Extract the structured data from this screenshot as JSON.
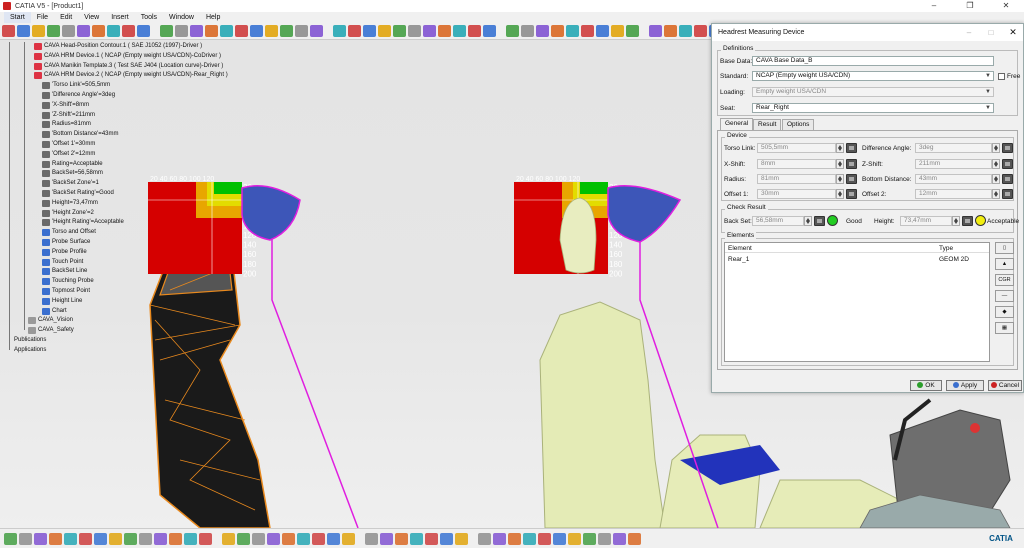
{
  "window": {
    "title": "CATIA V5 - [Product1]"
  },
  "menu": [
    "Start",
    "File",
    "Edit",
    "View",
    "Insert",
    "Tools",
    "Window",
    "Help"
  ],
  "tree": {
    "nodes": [
      {
        "label": "CAVA Head-Position Contour.1 ( SAE J1052 (1997)-Driver )",
        "icon": "red"
      },
      {
        "label": "CAVA HRM Device.1 ( NCAP (Empty weight USA/CDN)-CoDriver )",
        "icon": "red"
      },
      {
        "label": "CAVA Manikin Template.3 ( Test SAE J404 (Location curve)-Driver )",
        "icon": "red"
      },
      {
        "label": "CAVA HRM Device.2 ( NCAP (Empty weight USA/CDN)-Rear_Right )",
        "icon": "red"
      },
      {
        "label": "'Torso Link'=505,5mm",
        "icon": "param"
      },
      {
        "label": "'Difference Angle'=3deg",
        "icon": "param"
      },
      {
        "label": "'X-Shift'=8mm",
        "icon": "param"
      },
      {
        "label": "'Z-Shift'=211mm",
        "icon": "param"
      },
      {
        "label": "Radius=81mm",
        "icon": "param"
      },
      {
        "label": "'Bottom Distance'=43mm",
        "icon": "param"
      },
      {
        "label": "'Offset 1'=30mm",
        "icon": "param"
      },
      {
        "label": "'Offset 2'=12mm",
        "icon": "param"
      },
      {
        "label": "Rating=Acceptable",
        "icon": "param"
      },
      {
        "label": "BackSet=56,58mm",
        "icon": "param"
      },
      {
        "label": "'BackSet Zone'=1",
        "icon": "param"
      },
      {
        "label": "'BackSet Rating'=Good",
        "icon": "param"
      },
      {
        "label": "Height=73,47mm",
        "icon": "param"
      },
      {
        "label": "'Height Zone'=2",
        "icon": "param"
      },
      {
        "label": "'Height Rating'=Acceptable",
        "icon": "param"
      },
      {
        "label": "Torso and Offset",
        "icon": "blue"
      },
      {
        "label": "Probe Surface",
        "icon": "blue"
      },
      {
        "label": "Probe Profile",
        "icon": "blue"
      },
      {
        "label": "Touch Point",
        "icon": "blue"
      },
      {
        "label": "BackSet Line",
        "icon": "blue"
      },
      {
        "label": "Touching Probe",
        "icon": "blue"
      },
      {
        "label": "Topmost Point",
        "icon": "blue"
      },
      {
        "label": "Height Line",
        "icon": "blue"
      },
      {
        "label": "Chart",
        "icon": "blue"
      },
      {
        "label": "CAVA_Vision",
        "icon": "gray"
      },
      {
        "label": "CAVA_Safety",
        "icon": "gray"
      },
      {
        "label": "Publications",
        "icon": "none"
      },
      {
        "label": "Applications",
        "icon": "none"
      }
    ]
  },
  "chart_overlay": {
    "top_labels": "20 40 60 80 100 120",
    "right_labels": [
      "20",
      "40",
      "60",
      "80",
      "100",
      "120",
      "140",
      "160",
      "180",
      "200"
    ]
  },
  "dialog": {
    "title": "Headrest Measuring Device",
    "definitions_label": "Definitions",
    "base_data_label": "Base Data:",
    "base_data_value": "CAVA Base Data_B",
    "standard_label": "Standard:",
    "standard_value": "NCAP (Empty weight USA/CDN)",
    "free_label": "Free",
    "loading_label": "Loading:",
    "loading_value": "Empty weight USA/CDN",
    "seat_label": "Seat:",
    "seat_value": "Rear_Right",
    "tabs": [
      "General",
      "Result",
      "Options"
    ],
    "device_label": "Device",
    "torso_link_label": "Torso Link:",
    "torso_link_value": "505,5mm",
    "diff_angle_label": "Difference Angle:",
    "diff_angle_value": "3deg",
    "x_shift_label": "X-Shift:",
    "x_shift_value": "8mm",
    "z_shift_label": "Z-Shift:",
    "z_shift_value": "211mm",
    "radius_label": "Radius:",
    "radius_value": "81mm",
    "bottom_dist_label": "Bottom Distance:",
    "bottom_dist_value": "43mm",
    "offset1_label": "Offset 1:",
    "offset1_value": "30mm",
    "offset2_label": "Offset 2:",
    "offset2_value": "12mm",
    "check_result_label": "Check Result",
    "backset_label": "Back Set:",
    "backset_value": "56,58mm",
    "backset_rating": "Good",
    "backset_color": "#22cc22",
    "height_label": "Height:",
    "height_value": "73,47mm",
    "height_rating": "Acceptable",
    "height_color": "#f2ee10",
    "elements_label": "Elements",
    "col_element": "Element",
    "col_type": "Type",
    "rows": [
      {
        "element": "Rear_1",
        "type": "GEOM 2D"
      }
    ],
    "side_cgr": "CGR",
    "ok_label": "OK",
    "apply_label": "Apply",
    "cancel_label": "Cancel"
  },
  "logo": "CATIA"
}
